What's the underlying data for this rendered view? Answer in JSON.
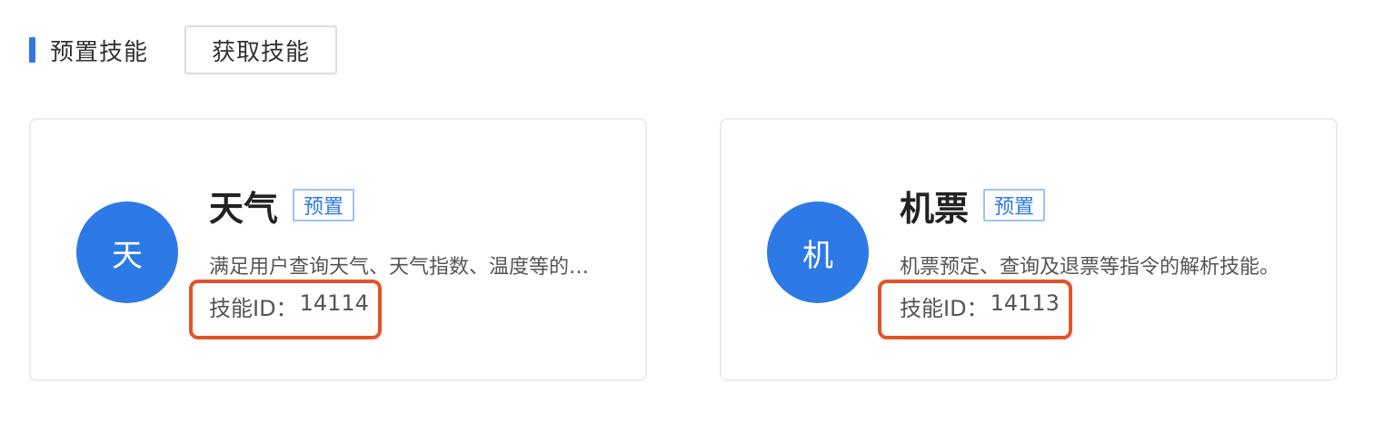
{
  "header": {
    "section_title": "预置技能",
    "get_skill_label": "获取技能",
    "accent_color": "#2d7ae6"
  },
  "cards": [
    {
      "avatar_char": "天",
      "title": "天气",
      "tag": "预置",
      "description": "满足用户查询天气、天气指数、温度等的…",
      "id_label": "技能ID：",
      "id_value": "14114"
    },
    {
      "avatar_char": "机",
      "title": "机票",
      "tag": "预置",
      "description": "机票预定、查询及退票等指令的解析技能。",
      "id_label": "技能ID：",
      "id_value": "14113"
    }
  ],
  "colors": {
    "primary_blue": "#2d7ae6",
    "highlight_red": "#e45328",
    "tag_border": "#9fc2f3"
  }
}
